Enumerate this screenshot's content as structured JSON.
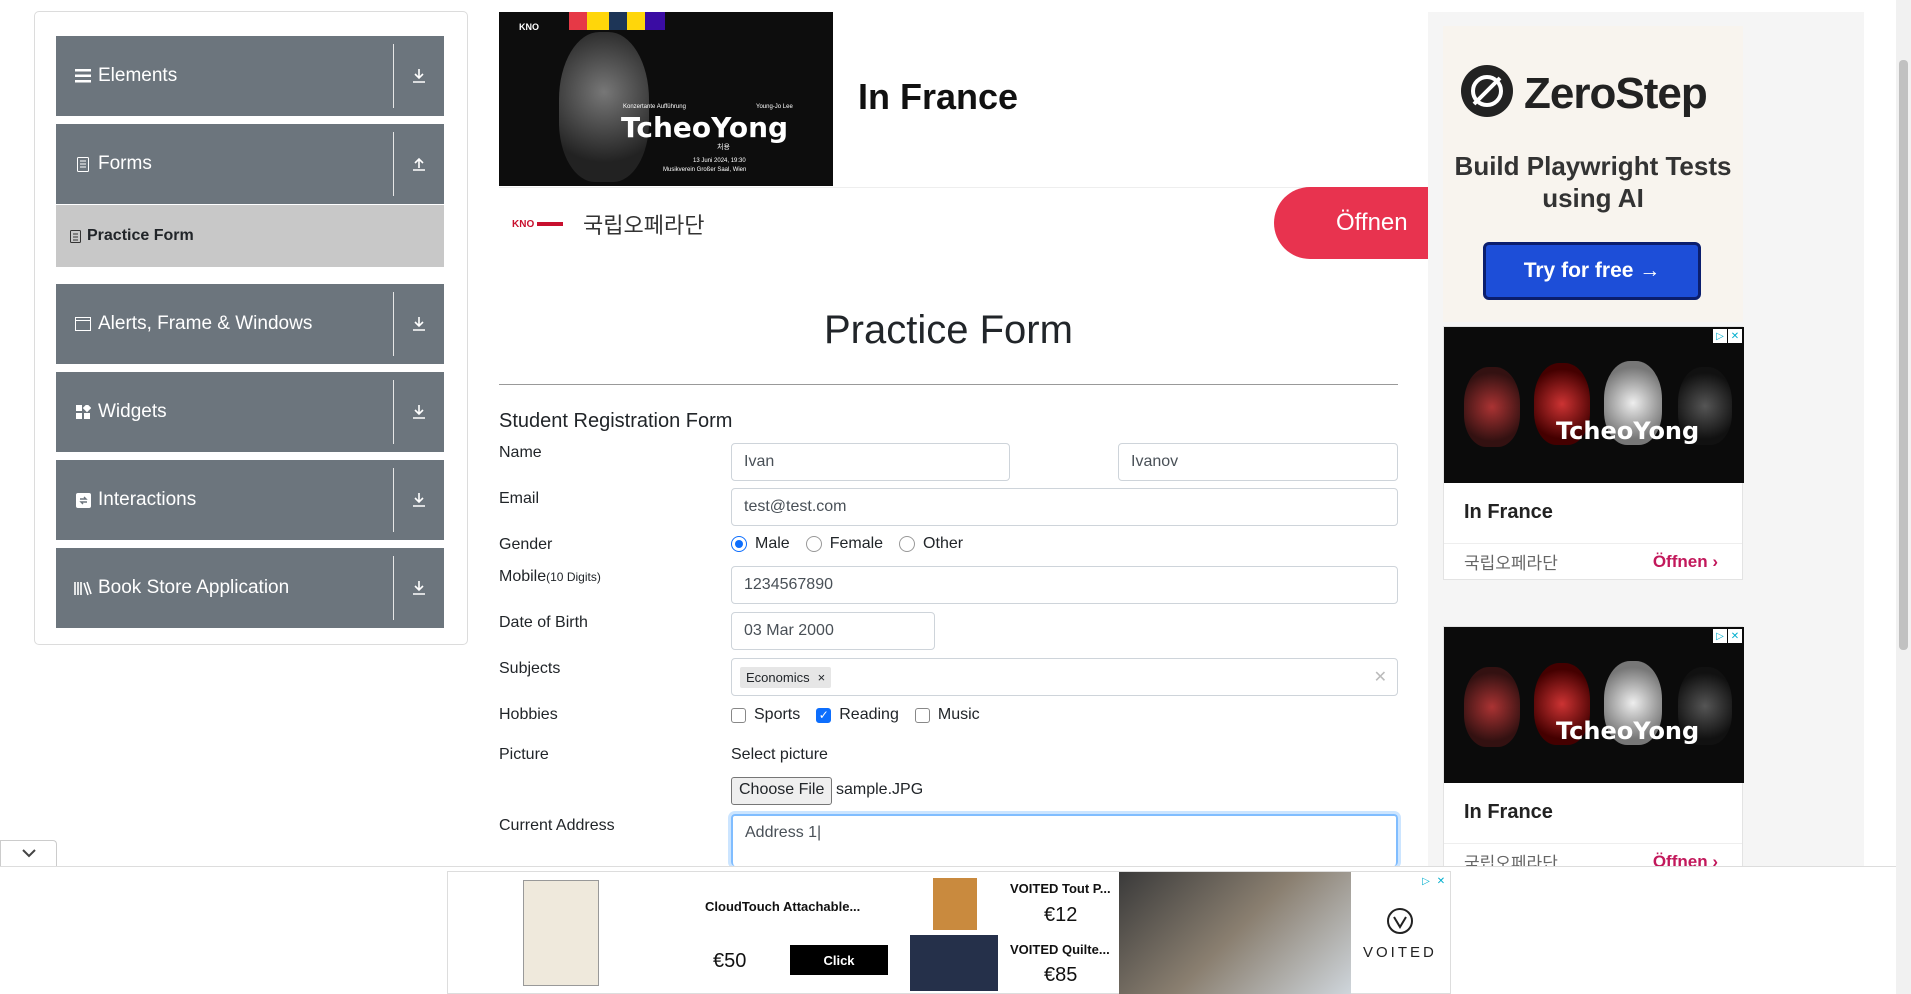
{
  "sidebar": {
    "groups": [
      {
        "label": "Elements",
        "icon": "menu-icon"
      },
      {
        "label": "Forms",
        "icon": "document-icon"
      },
      {
        "label": "Alerts, Frame & Windows",
        "icon": "window-icon"
      },
      {
        "label": "Widgets",
        "icon": "widgets-icon"
      },
      {
        "label": "Interactions",
        "icon": "interactions-icon"
      },
      {
        "label": "Book Store Application",
        "icon": "books-icon"
      }
    ],
    "active_item": "Practice Form"
  },
  "top_ad": {
    "poster_title": "TcheoYong",
    "poster_sub": "Konzertante Aufführung",
    "poster_author": "Young-Jo Lee",
    "poster_korean": "처용",
    "poster_date": "13 Juni 2024, 19:30",
    "poster_venue": "Musikverein Großer Saal, Wien",
    "logo_text": "KNO",
    "title": "In France",
    "korean": "국립오페라단",
    "open": "Öffnen"
  },
  "form": {
    "page_title": "Practice Form",
    "heading": "Student Registration Form",
    "labels": {
      "name": "Name",
      "email": "Email",
      "gender": "Gender",
      "mobile": "Mobile",
      "mobile_hint": "(10 Digits)",
      "dob": "Date of Birth",
      "subjects": "Subjects",
      "hobbies": "Hobbies",
      "picture": "Picture",
      "address": "Current Address"
    },
    "first_name": "Ivan",
    "last_name": "Ivanov",
    "email": "test@test.com",
    "gender_options": [
      "Male",
      "Female",
      "Other"
    ],
    "gender_selected": "Male",
    "mobile": "1234567890",
    "dob": "03 Mar 2000",
    "subject_tag": "Economics",
    "hobby_options": [
      "Sports",
      "Reading",
      "Music"
    ],
    "hobby_selected": [
      "Reading"
    ],
    "picture_caption": "Select picture",
    "file_button": "Choose File",
    "file_name": "sample.JPG",
    "address": "Address 1|"
  },
  "right_ads": {
    "zerostep": {
      "brand": "ZeroStep",
      "tagline": "Build Playwright Tests using AI",
      "button": "Try for free →"
    },
    "cards": [
      {
        "title": "In France",
        "korean": "국립오페라단",
        "open": "Öffnen",
        "poster_title": "TcheoYong"
      },
      {
        "title": "In France",
        "korean": "국립오페라단",
        "open": "Öffnen",
        "poster_title": "TcheoYong"
      }
    ]
  },
  "bottom_ad": {
    "product1": "CloudTouch Attachable...",
    "price1": "€50",
    "click": "Click",
    "product2": "VOITED Tout P...",
    "price2": "€12",
    "product3": "VOITED Quilte...",
    "price3": "€85",
    "brand": "VOITED"
  },
  "colors": {
    "sidebar_group": "#6c757d",
    "active_item": "#c8c8c8",
    "open_button": "#e8334f",
    "primary": "#0d6efd",
    "zerostep_button": "#1d4ed8"
  }
}
